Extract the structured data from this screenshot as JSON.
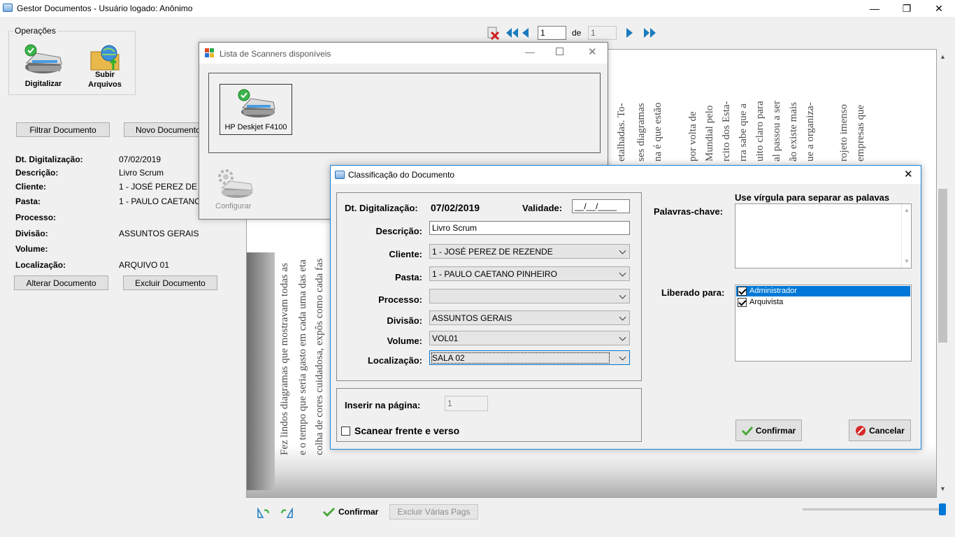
{
  "window": {
    "title": "Gestor Documentos - Usuário logado: Anônimo",
    "minimize": "—",
    "restore": "❐",
    "close": "✕"
  },
  "operations": {
    "group_label": "Operações",
    "scan_label": "Digitalizar",
    "upload_label_1": "Subir",
    "upload_label_2": "Arquivos"
  },
  "left_buttons": {
    "filter": "Filtrar Documento",
    "new": "Novo Documento",
    "edit": "Alterar Documento",
    "delete": "Excluir Documento"
  },
  "details": [
    {
      "label": "Dt. Digitalização:",
      "value": "07/02/2019"
    },
    {
      "label": "Descrição:",
      "value": "Livro Scrum"
    },
    {
      "label": "Cliente:",
      "value": "1 - JOSÉ PEREZ DE"
    },
    {
      "label": "Pasta:",
      "value": "1 - PAULO CAETANO"
    },
    {
      "label": "Processo:",
      "value": ""
    },
    {
      "label": "Divisão:",
      "value": "ASSUNTOS GERAIS"
    },
    {
      "label": "Volume:",
      "value": ""
    },
    {
      "label": "Localização:",
      "value": "ARQUIVO 01"
    }
  ],
  "pager": {
    "current": "1",
    "of_label": "de",
    "total": "1"
  },
  "scanner_dialog": {
    "title": "Lista de Scanners disponíveis",
    "scanner_name": "HP Deskjet F4100",
    "configure_label": "Configurar"
  },
  "classification": {
    "title": "Classificação do Documento",
    "date_label": "Dt. Digitalização:",
    "date_value": "07/02/2019",
    "validity_label": "Validade:",
    "validity_value": "__/__/____",
    "description_label": "Descrição:",
    "description_value": "Livro Scrum",
    "client_label": "Cliente:",
    "client_value": "1 - JOSÉ PEREZ DE REZENDE",
    "folder_label": "Pasta:",
    "folder_value": "1 - PAULO CAETANO PINHEIRO",
    "process_label": "Processo:",
    "process_value": "",
    "division_label": "Divisão:",
    "division_value": "ASSUNTOS GERAIS",
    "volume_label": "Volume:",
    "volume_value": "VOL01",
    "location_label": "Localização:",
    "location_value": "SALA 02",
    "insert_page_label": "Inserir na página:",
    "insert_page_value": "1",
    "duplex_label": "Scanear frente e verso",
    "keywords_label": "Palavras-chave:",
    "keywords_hint": "Use vírgula para separar as palavas",
    "released_label": "Liberado para:",
    "released_options": [
      {
        "label": "Administrador",
        "checked": true
      },
      {
        "label": "Arquivista",
        "checked": true
      }
    ],
    "confirm_label": "Confirmar",
    "cancel_label": "Cancelar"
  },
  "bottom": {
    "confirm_label": "Confirmar",
    "delete_pages_label": "Excluir Várias Pags"
  },
  "scan_text": [
    "Fez lindos diagramas que mostravam todas as",
    "e o tempo que seria gasto em cada uma das eta",
    "colha de cores cuidadosa, expôs como cada fas",
    "etalhadas. To-",
    "ses diagramas",
    "na é que estão",
    "por volta de",
    "Mundial pelo",
    "rcito dos Esta-",
    "rra sabe que a",
    "uito claro para",
    "al passou a ser",
    "ão existe mais",
    "ue a organiza-",
    "rojeto imenso",
    "empresas que"
  ],
  "colors": {
    "accent": "#0078d7",
    "dialog_border": "#1883d7"
  }
}
